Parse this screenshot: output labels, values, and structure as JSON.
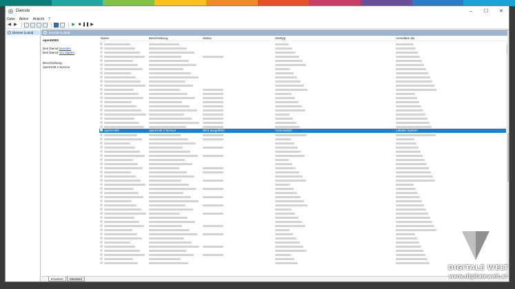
{
  "colors": {
    "strip": [
      "#0b7d76",
      "#1ea7a0",
      "#7fc241",
      "#f6c21b",
      "#f08a24",
      "#e8502a",
      "#c83d63",
      "#6a4e9a",
      "#2a7bc6",
      "#1ba5d6"
    ],
    "selection": "#1a7fd6",
    "header": "#9bb4d0"
  },
  "window": {
    "title": "Dienste",
    "controls": {
      "minimize": "–",
      "maximize": "☐",
      "close": "✕"
    }
  },
  "menu": [
    "Datei",
    "Aktion",
    "Ansicht",
    "?"
  ],
  "toolbar": {
    "icons": [
      "back-icon",
      "forward-icon",
      "console-tree-icon",
      "list-icon",
      "refresh-icon",
      "export-icon",
      "help-icon",
      "properties-icon",
      "play-icon",
      "stop-icon",
      "pause-icon",
      "restart-icon"
    ]
  },
  "tree": {
    "item": "Dienste (Lokal)"
  },
  "main": {
    "header": "Dienste (Lokal)"
  },
  "description": {
    "service_title": "openHAB2",
    "stop_prefix": "Den Dienst",
    "stop_link": "beenden",
    "restart_prefix": "Den Dienst",
    "restart_link": "neu starten",
    "label": "Beschreibung:",
    "text": "openHAB 2 Service"
  },
  "columns": [
    "Name",
    "Beschreibung",
    "Status",
    "Starttyp",
    "Anmelden als"
  ],
  "selected_row": {
    "name": "openHAB2",
    "beschreibung": "openHAB 2 Service",
    "status": "Wird ausgeführt",
    "starttyp": "Automatisch",
    "anmelden": "Lokales System"
  },
  "tabs": [
    "Erweitert",
    "Standard"
  ],
  "watermark": {
    "brand": "DIGITALE WELT",
    "site": "www.digitalewelt.at"
  }
}
